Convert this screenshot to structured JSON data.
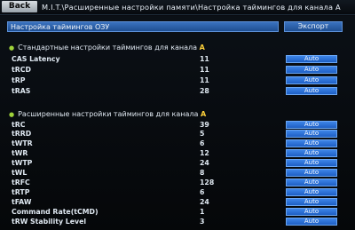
{
  "top": {
    "back_label": "Back",
    "breadcrumb": "M.I.T.\\Расширенные настройки памяти\\Настройка таймингов для канала A"
  },
  "panel": {
    "title": "Настройка таймингов ОЗУ",
    "export_label": "Экспорт"
  },
  "standard": {
    "header": "Стандартные настройки таймингов для канала",
    "channel": "A",
    "rows": [
      {
        "label": "CAS Latency",
        "value": "11",
        "action": "Auto"
      },
      {
        "label": "tRCD",
        "value": "11",
        "action": "Auto"
      },
      {
        "label": "tRP",
        "value": "11",
        "action": "Auto"
      },
      {
        "label": "tRAS",
        "value": "28",
        "action": "Auto"
      }
    ]
  },
  "advanced": {
    "header": "Расширенные настройки таймингов для канала",
    "channel": "A",
    "rows": [
      {
        "label": "tRC",
        "value": "39",
        "action": "Auto"
      },
      {
        "label": "tRRD",
        "value": "5",
        "action": "Auto"
      },
      {
        "label": "tWTR",
        "value": "6",
        "action": "Auto"
      },
      {
        "label": "tWR",
        "value": "12",
        "action": "Auto"
      },
      {
        "label": "tWTP",
        "value": "24",
        "action": "Auto"
      },
      {
        "label": "tWL",
        "value": "8",
        "action": "Auto"
      },
      {
        "label": "tRFC",
        "value": "128",
        "action": "Auto"
      },
      {
        "label": "tRTP",
        "value": "6",
        "action": "Auto"
      },
      {
        "label": "tFAW",
        "value": "24",
        "action": "Auto"
      },
      {
        "label": "Command Rate(tCMD)",
        "value": "1",
        "action": "Auto"
      },
      {
        "label": "tRW Stability Level",
        "value": "3",
        "action": "Auto"
      }
    ]
  },
  "colors": {
    "accent_blue": "#2f6fd6",
    "section_bullet": "#9fd23a",
    "channel_letter": "#ffd23a"
  }
}
